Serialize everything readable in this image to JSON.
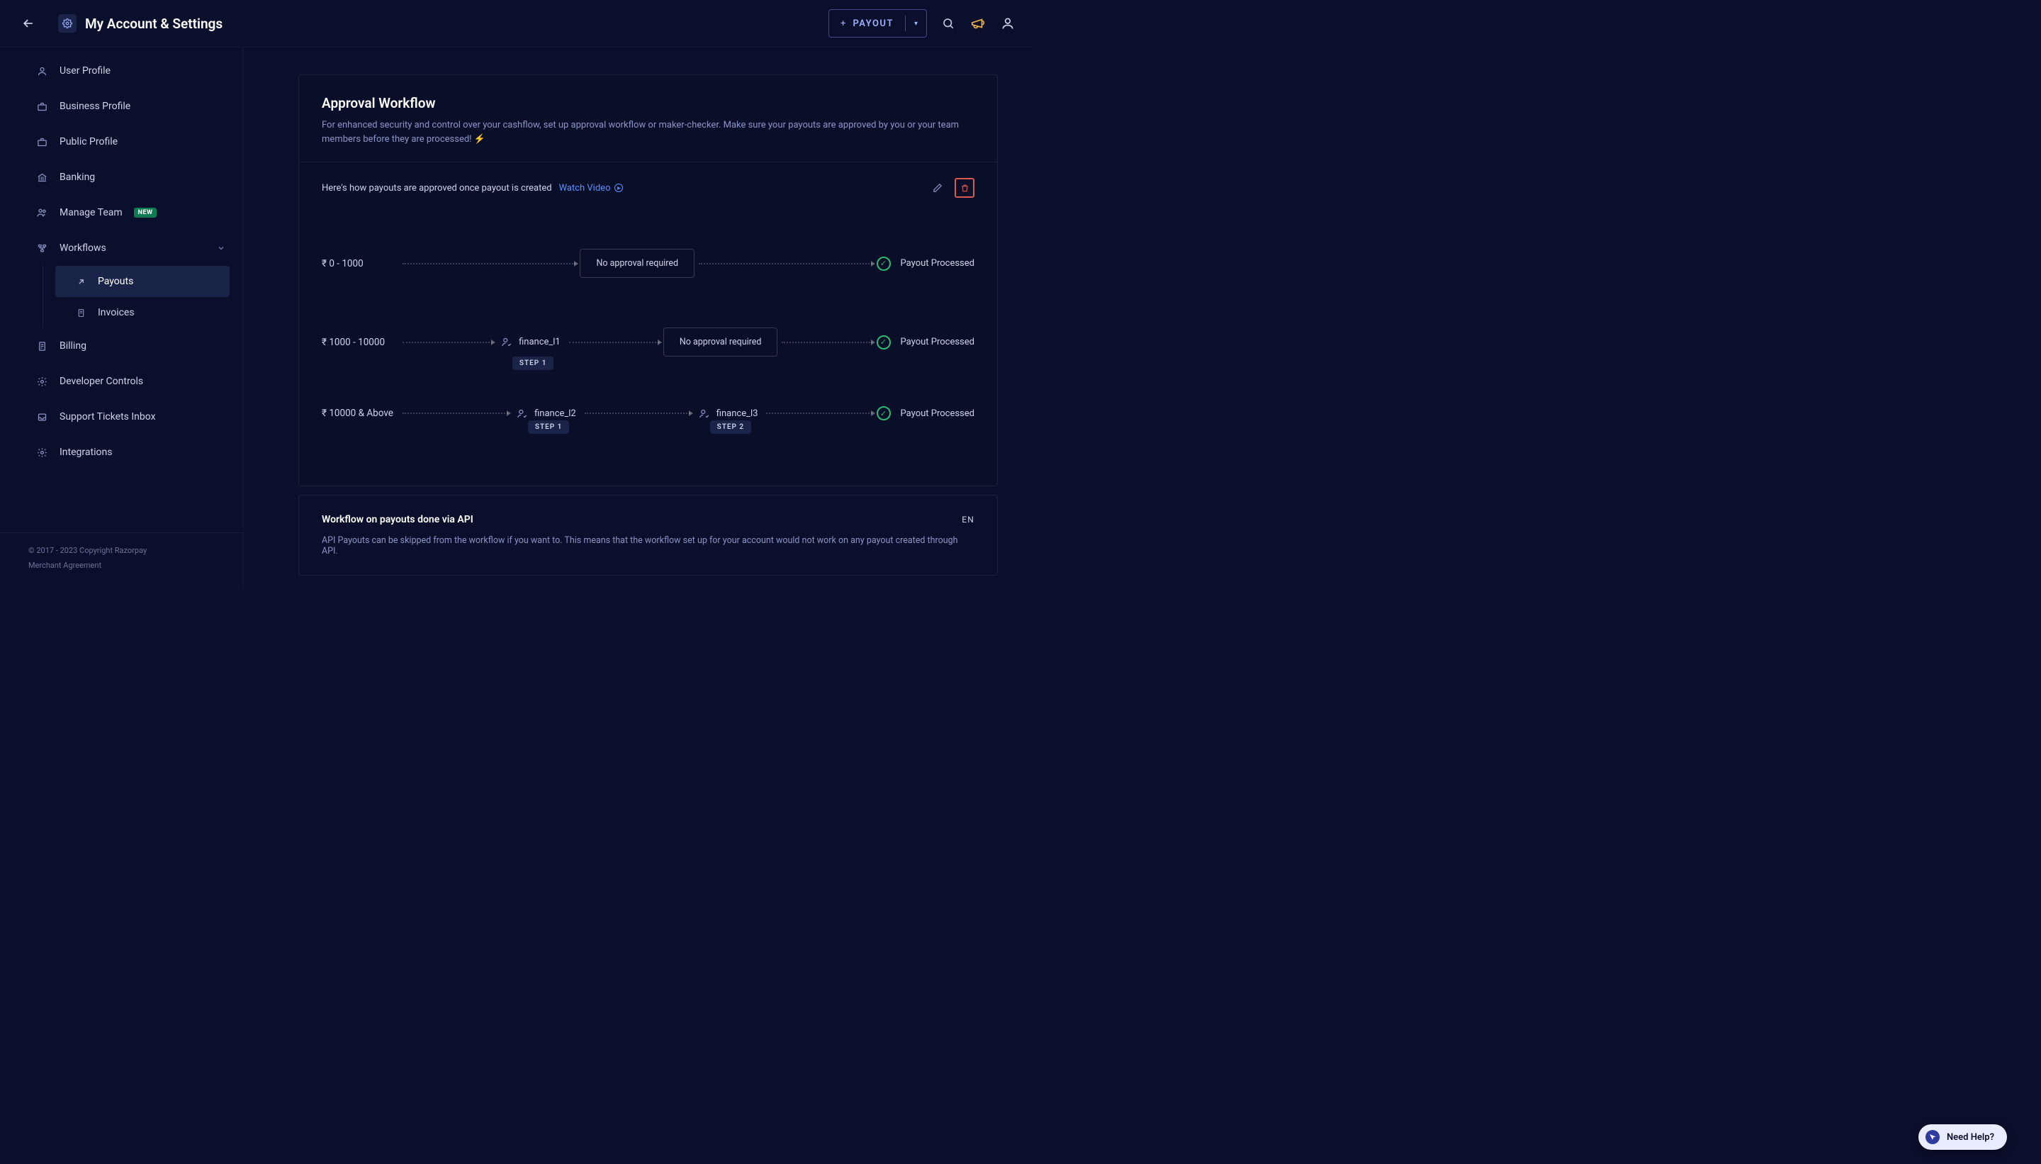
{
  "header": {
    "title": "My Account & Settings",
    "payout_button": "PAYOUT"
  },
  "sidebar": {
    "items": {
      "user_profile": "User Profile",
      "business_profile": "Business Profile",
      "public_profile": "Public Profile",
      "banking": "Banking",
      "manage_team": "Manage Team",
      "manage_team_badge": "NEW",
      "workflows": "Workflows",
      "payouts": "Payouts",
      "invoices": "Invoices",
      "billing": "Billing",
      "developer_controls": "Developer Controls",
      "support_tickets": "Support Tickets Inbox",
      "integrations": "Integrations"
    }
  },
  "footer": {
    "copyright": "© 2017 - 2023 Copyright Razorpay",
    "merchant": "Merchant Agreement"
  },
  "approval": {
    "title": "Approval Workflow",
    "subtitle": "For enhanced security and control over your cashflow, set up approval workflow or maker-checker. Make sure your payouts are approved by you or your team members before they are processed! ⚡",
    "info": "Here's how payouts are approved once payout is created",
    "watch": "Watch Video"
  },
  "workflow": {
    "rows": [
      {
        "range": "₹ 0 - 1000",
        "steps": [],
        "nodes": [
          {
            "kind": "box",
            "label": "No approval required"
          }
        ],
        "result": "Payout Processed"
      },
      {
        "range": "₹ 1000 - 10000",
        "steps": [
          "STEP 1"
        ],
        "nodes": [
          {
            "kind": "approver",
            "label": "finance_l1"
          },
          {
            "kind": "box",
            "label": "No approval required"
          }
        ],
        "result": "Payout Processed"
      },
      {
        "range": "₹ 10000 & Above",
        "steps": [
          "STEP 1",
          "STEP 2"
        ],
        "nodes": [
          {
            "kind": "approver",
            "label": "finance_l2"
          },
          {
            "kind": "approver",
            "label": "finance_l3"
          }
        ],
        "result": "Payout Processed"
      }
    ]
  },
  "api": {
    "title": "Workflow on payouts done via API",
    "status_prefix": "EN",
    "desc": "API Payouts can be skipped from the workflow if you want to. This means that the workflow set up for your account would not work on any payout created through API."
  },
  "help": {
    "label": "Need Help?"
  }
}
